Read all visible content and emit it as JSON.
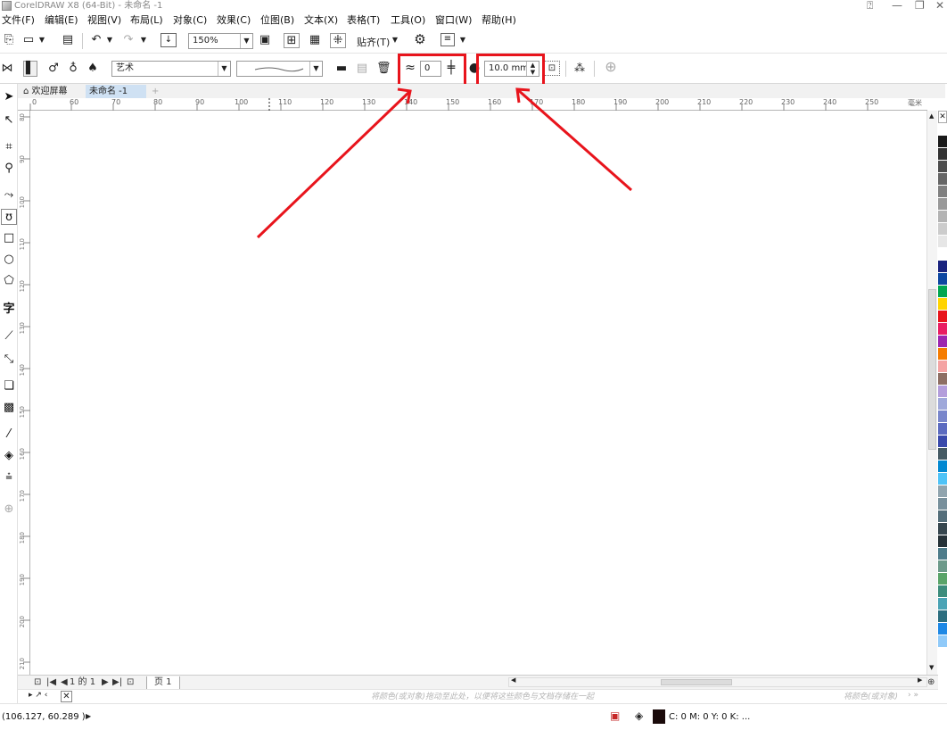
{
  "window": {
    "title": "CorelDRAW X8 (64-Bit) - 未命名 -1"
  },
  "menu": [
    "文件(F)",
    "编辑(E)",
    "视图(V)",
    "布局(L)",
    "对象(C)",
    "效果(C)",
    "位图(B)",
    "文本(X)",
    "表格(T)",
    "工具(O)",
    "窗口(W)",
    "帮助(H)"
  ],
  "toolbar": {
    "zoom": "150%",
    "snap_label": "贴齐(T)"
  },
  "propbar": {
    "brush_category": "艺术",
    "smoothing_value": "0",
    "width_value": "10.0 mm"
  },
  "tabs": {
    "welcome": "欢迎屏幕",
    "doc": "未命名 -1"
  },
  "ruler": {
    "h_ticks": [
      "0",
      "60",
      "70",
      "80",
      "90",
      "100",
      "110",
      "120",
      "130",
      "140",
      "150",
      "160",
      "170",
      "180",
      "190",
      "200",
      "210",
      "220",
      "230",
      "240",
      "250"
    ],
    "unit": "毫米",
    "v_ticks": [
      "80",
      "90",
      "100",
      "110",
      "120",
      "130",
      "140",
      "150",
      "160",
      "170",
      "180",
      "190",
      "200",
      "210",
      "220",
      "230"
    ]
  },
  "pagebar": {
    "page_count": "1 的 1",
    "page_tab": "页 1"
  },
  "colortray": {
    "hint": "将颜色(或对象)拖动至此处，以便将这些颜色与文档存储在一起",
    "hint_right": "将颜色(或对象)"
  },
  "status": {
    "coords": "(106.127, 60.289 )",
    "fill": "C: 0 M: 0 Y: 0 K: ..."
  },
  "palette": [
    "#ffffff",
    "#1a1a1a",
    "#333333",
    "#4d4d4d",
    "#666666",
    "#808080",
    "#999999",
    "#b3b3b3",
    "#cccccc",
    "#e6e6e6",
    "#ffffff",
    "#1a237e",
    "#0d47a1",
    "#00a651",
    "#ffd400",
    "#e8141c",
    "#e91e63",
    "#9c27b0",
    "#f57c00",
    "#f4a3a3",
    "#8d6e63",
    "#b39ddb",
    "#9fa8da",
    "#7986cb",
    "#5c6bc0",
    "#3949ab",
    "#455a64",
    "#0288d1",
    "#4fc3f7",
    "#90a4ae",
    "#78909c",
    "#546e7a",
    "#37474f",
    "#263238",
    "#4e7c8a",
    "#6d9a8a",
    "#5aa469",
    "#3c8c7c",
    "#4aa3b5",
    "#2c6e7f",
    "#1e88e5",
    "#90caf9"
  ],
  "colors": {
    "highlight": "#e8141c",
    "active_tab": "#cfe1f3"
  }
}
